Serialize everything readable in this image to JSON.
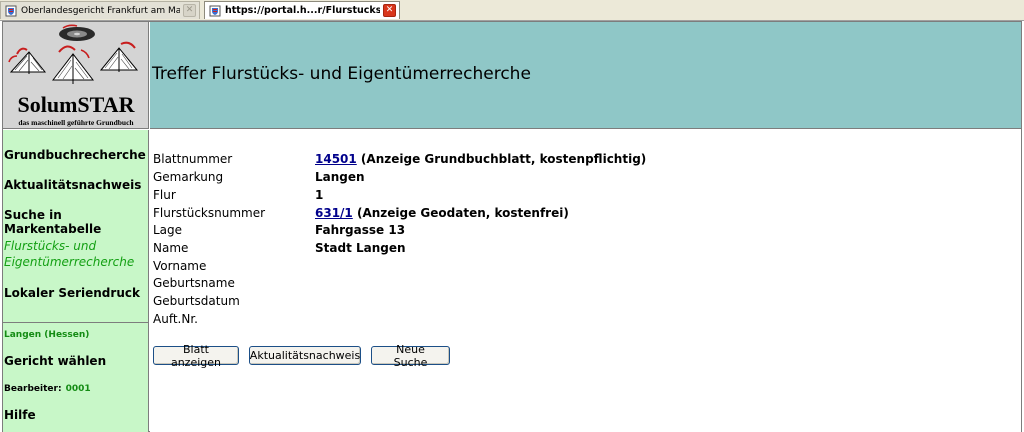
{
  "browser": {
    "tabs": [
      {
        "title": "Oberlandesgericht Frankfurt am Main - ...",
        "active": false
      },
      {
        "title": "https://portal.h...r/Flurstucks.htm",
        "active": true
      }
    ]
  },
  "logo": {
    "brand": "SolumSTAR",
    "tagline": "das maschinell geführte Grundbuch"
  },
  "header": {
    "title": "Treffer Flurstücks- und Eigentümerrecherche"
  },
  "sidebar": {
    "items": [
      {
        "label": "Grundbuchrecherche"
      },
      {
        "label": "Aktualitätsnachweis"
      },
      {
        "label": "Suche in Markentabelle"
      },
      {
        "label": "Flurstücks- und Eigentümerrecherche"
      },
      {
        "label": "Lokaler Seriendruck"
      }
    ],
    "location": "Langen (Hessen)",
    "court_select": "Gericht wählen",
    "bearbeiter_label": "Bearbeiter:",
    "bearbeiter_value": "0001",
    "help": "Hilfe"
  },
  "details": {
    "blattnummer_label": "Blattnummer",
    "blattnummer_link": "14501",
    "blattnummer_note": " (Anzeige Grundbuchblatt, kostenpflichtig)",
    "gemarkung_label": "Gemarkung",
    "gemarkung_value": "Langen",
    "flur_label": "Flur",
    "flur_value": "1",
    "flurstueck_label": "Flurstücksnummer",
    "flurstueck_link": "631/1",
    "flurstueck_note": " (Anzeige Geodaten, kostenfrei)",
    "lage_label": "Lage",
    "lage_value": "Fahrgasse 13",
    "name_label": "Name",
    "name_value": "Stadt Langen",
    "vorname_label": "Vorname",
    "geburtsname_label": "Geburtsname",
    "geburtsdatum_label": "Geburtsdatum",
    "auft_label": "Auft.Nr."
  },
  "buttons": {
    "show_sheet": "Blatt anzeigen",
    "currency_proof": "Aktualitätsnachweis",
    "new_search": "Neue Suche"
  },
  "colors": {
    "header_bg": "#8fc7c7",
    "sidebar_bg": "#c8f7c8",
    "link": "#00008b",
    "active_nav": "#14a014"
  }
}
